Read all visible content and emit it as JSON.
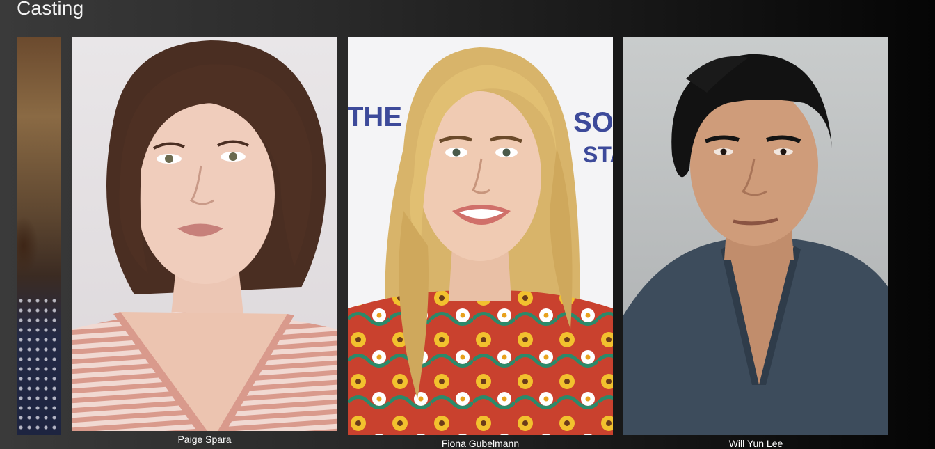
{
  "section": {
    "title": "Casting"
  },
  "cast": [
    {
      "name": ""
    },
    {
      "name": "Paige Spara"
    },
    {
      "name": "Fiona Gubelmann"
    },
    {
      "name": "Will Yun Lee"
    }
  ],
  "backdrop_text": {
    "left": "THE",
    "right_top": "SO",
    "right_bottom": "STA"
  },
  "colors": {
    "background_dark": "#050505",
    "background_light": "#3a3a3a",
    "caption_text": "#ffffff",
    "backdrop_logo": "#3d4a9a"
  }
}
